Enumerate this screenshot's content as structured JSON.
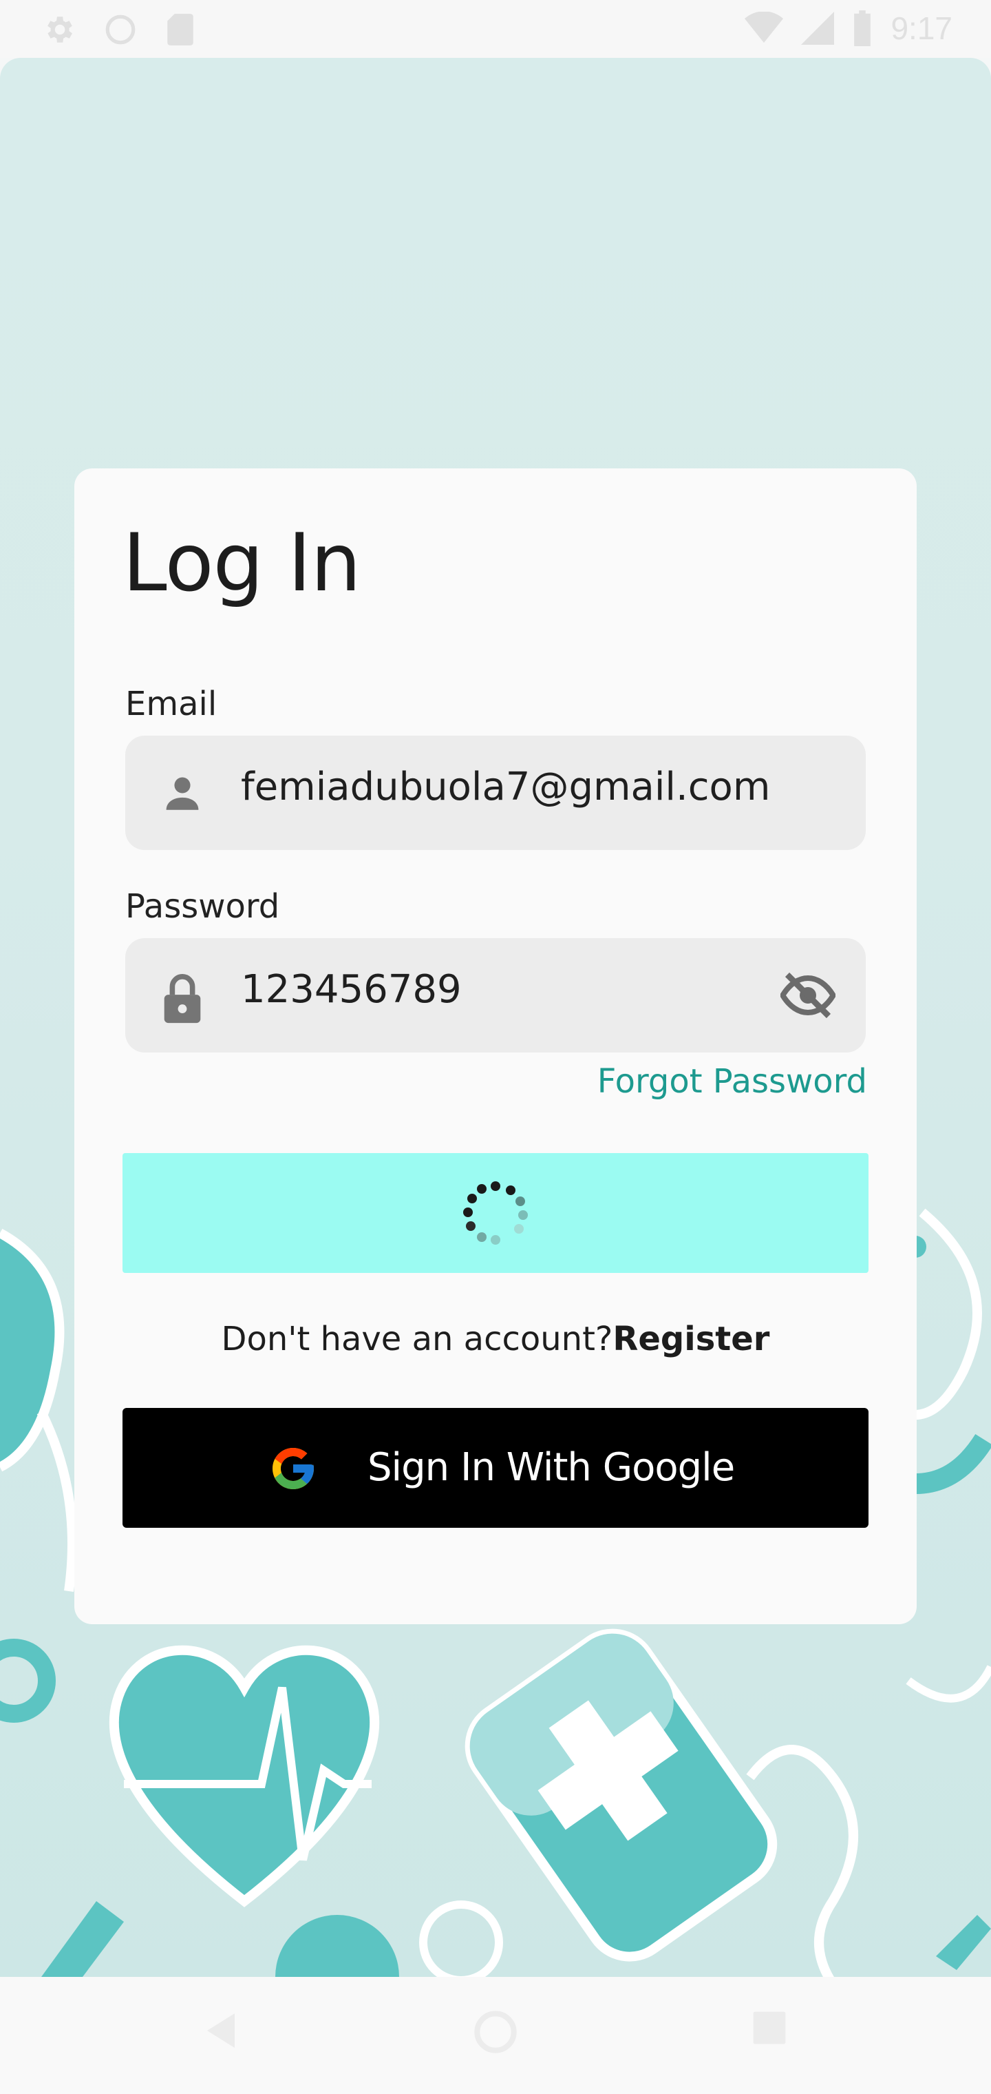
{
  "status_bar": {
    "time": "9:17",
    "icons": [
      "settings-icon",
      "sync-icon",
      "sd-card-icon",
      "wifi-icon",
      "cellular-icon",
      "battery-icon"
    ]
  },
  "login": {
    "title": "Log In",
    "email_label": "Email",
    "email_value": "femiadubuola7@gmail.com",
    "password_label": "Password",
    "password_value": "123456789",
    "forgot_password": "Forgot Password",
    "register_prompt": "Don't have an account?",
    "register_link": "Register",
    "google_button": "Sign In With Google"
  },
  "colors": {
    "accent": "#1d9a8f",
    "login_button": "#9bfbf2",
    "google_button": "#000000",
    "background": "#d8eceb"
  },
  "nav_bar": {
    "icons": [
      "back-icon",
      "home-icon",
      "recents-icon"
    ]
  }
}
